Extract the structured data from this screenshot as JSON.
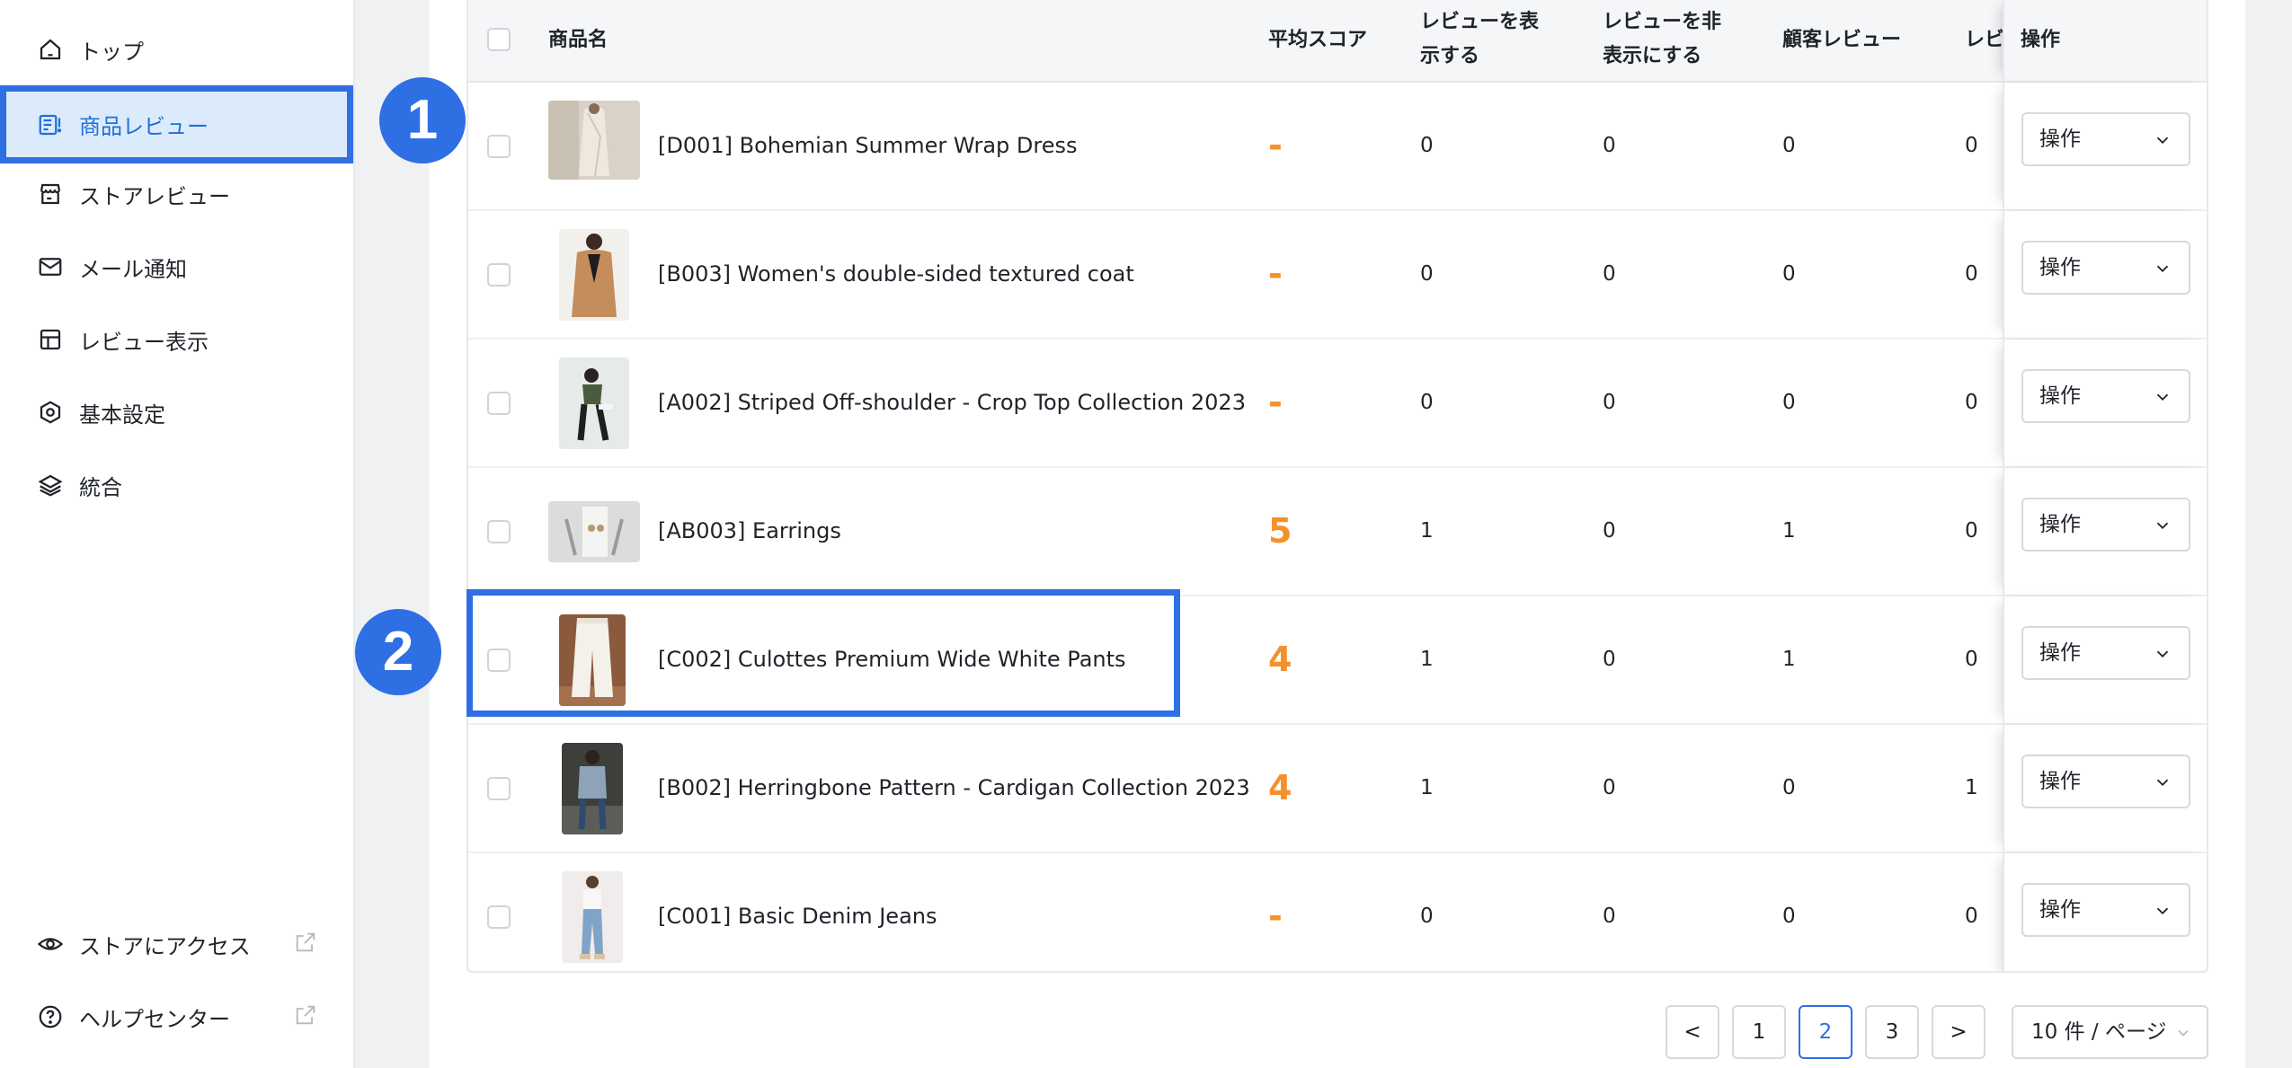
{
  "sidebar": {
    "items": [
      {
        "label": "トップ",
        "icon": "home-icon"
      },
      {
        "label": "商品レビュー",
        "icon": "product-review-icon",
        "active": true
      },
      {
        "label": "ストアレビュー",
        "icon": "store-icon"
      },
      {
        "label": "メール通知",
        "icon": "mail-icon"
      },
      {
        "label": "レビュー表示",
        "icon": "layout-icon"
      },
      {
        "label": "基本設定",
        "icon": "settings-hex-icon"
      },
      {
        "label": "統合",
        "icon": "layers-icon"
      }
    ],
    "bottom": [
      {
        "label": "ストアにアクセス",
        "icon": "eye-icon",
        "external": true
      },
      {
        "label": "ヘルプセンター",
        "icon": "help-circle-icon",
        "external": true
      }
    ]
  },
  "table": {
    "headers": {
      "name": "商品名",
      "avg_score": "平均スコア",
      "show_reviews": "レビューを表示する",
      "hide_reviews": "レビューを非表示にする",
      "customer_reviews": "顧客レビュー",
      "col_truncated": "レビ",
      "action": "操作"
    },
    "rows": [
      {
        "name": "[D001] Bohemian Summer Wrap Dress",
        "score": "-",
        "show": "0",
        "hide": "0",
        "customer": "0",
        "other": "0",
        "action": "操作"
      },
      {
        "name": "[B003] Women's double-sided textured coat",
        "score": "-",
        "show": "0",
        "hide": "0",
        "customer": "0",
        "other": "0",
        "action": "操作"
      },
      {
        "name": "[A002] Striped Off-shoulder - Crop Top Collection 2023",
        "score": "-",
        "show": "0",
        "hide": "0",
        "customer": "0",
        "other": "0",
        "action": "操作"
      },
      {
        "name": "[AB003] Earrings",
        "score": "5",
        "show": "1",
        "hide": "0",
        "customer": "1",
        "other": "0",
        "action": "操作"
      },
      {
        "name": "[C002] Culottes Premium Wide White Pants",
        "score": "4",
        "show": "1",
        "hide": "0",
        "customer": "1",
        "other": "0",
        "action": "操作"
      },
      {
        "name": "[B002] Herringbone Pattern - Cardigan Collection 2023",
        "score": "4",
        "show": "1",
        "hide": "0",
        "customer": "0",
        "other": "1",
        "action": "操作"
      },
      {
        "name": "[C001] Basic Denim Jeans",
        "score": "-",
        "show": "0",
        "hide": "0",
        "customer": "0",
        "other": "0",
        "action": "操作"
      }
    ]
  },
  "pagination": {
    "prev": "<",
    "pages": [
      "1",
      "2",
      "3"
    ],
    "current": "2",
    "next": ">",
    "page_size": "10 件 / ページ"
  },
  "annotations": {
    "step1": "1",
    "step2": "2"
  },
  "colors": {
    "accent": "#2f6fe4",
    "score": "#f5902b",
    "active_bg": "#dcebfb"
  }
}
